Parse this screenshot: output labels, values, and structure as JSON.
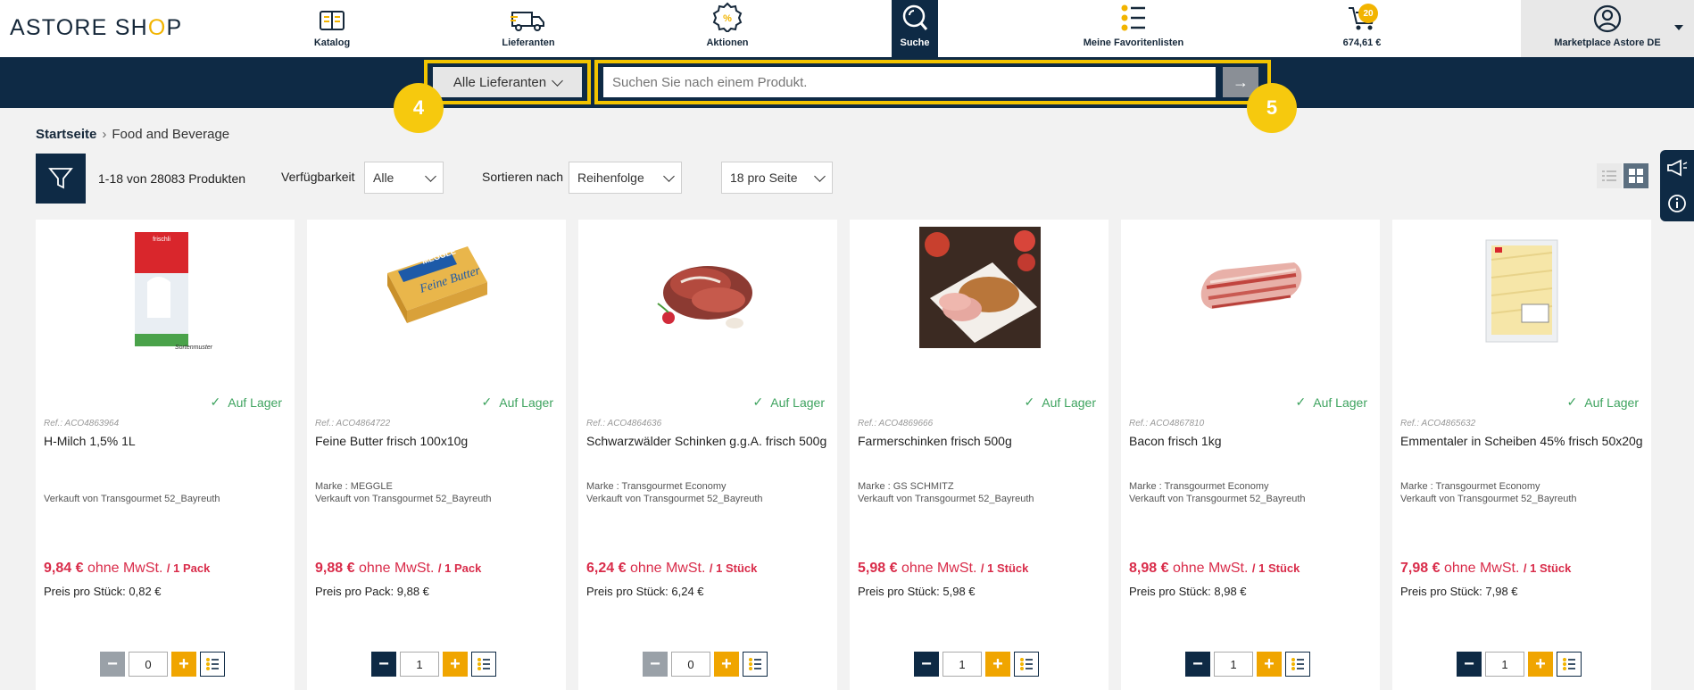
{
  "header": {
    "logo_prefix": "ASTORE SH",
    "logo_o": "O",
    "logo_suffix": "P",
    "nav": [
      {
        "label": "Katalog",
        "icon": "catalog-book-icon"
      },
      {
        "label": "Lieferanten",
        "icon": "delivery-truck-icon"
      },
      {
        "label": "Aktionen",
        "icon": "discount-badge-icon"
      },
      {
        "label": "Suche",
        "icon": "search-icon",
        "active": true
      },
      {
        "label": "Meine Favoritenlisten",
        "icon": "favorite-list-icon"
      },
      {
        "label": "674,61 €",
        "icon": "shopping-cart-icon",
        "badge": "20"
      }
    ],
    "account_label": "Marketplace Astore DE"
  },
  "search": {
    "supplier_select": "Alle Lieferanten",
    "placeholder": "Suchen Sie nach einem Produkt.",
    "submit_glyph": "→",
    "callouts": [
      "4",
      "5"
    ]
  },
  "breadcrumb": {
    "home": "Startseite",
    "current": "Food and Beverage"
  },
  "toolbar": {
    "count": "1-18 von 28083 Produkten",
    "availability_label": "Verfügbarkeit",
    "availability_value": "Alle",
    "sort_label": "Sortieren nach",
    "sort_value": "Reihenfolge",
    "per_page_value": "18 pro Seite"
  },
  "colors": {
    "navy": "#0e2a45",
    "accent": "#f0a500",
    "price": "#d92c4a",
    "stock": "#3ea35f"
  },
  "products": [
    {
      "stock": "Auf Lager",
      "ref": "Ref.: ACO4863964",
      "name": "H-Milch 1,5% 1L",
      "marke": "",
      "seller": "Verkauft von Transgourmet 52_Bayreuth",
      "price": "9,84 €",
      "vat": "ohne MwSt.",
      "unit": "/ 1 Pack",
      "ppu": "Preis pro Stück: 0,82 €",
      "qty": "0",
      "image": "milk-carton-image",
      "image_caption": "Sortenmuster"
    },
    {
      "stock": "Auf Lager",
      "ref": "Ref.: ACO4864722",
      "name": "Feine Butter frisch 100x10g",
      "marke": "Marke : MEGGLE",
      "seller": "Verkauft von Transgourmet 52_Bayreuth",
      "price": "9,88 €",
      "vat": "ohne MwSt.",
      "unit": "/ 1 Pack",
      "ppu": "Preis pro Pack: 9,88 €",
      "qty": "1",
      "image": "butter-pack-image",
      "image_brand": "MEGGLE",
      "image_text": "Feine Butter"
    },
    {
      "stock": "Auf Lager",
      "ref": "Ref.: ACO4864636",
      "name": "Schwarzwälder Schinken g.g.A. frisch 500g",
      "marke": "Marke : Transgourmet Economy",
      "seller": "Verkauft von Transgourmet 52_Bayreuth",
      "price": "6,24 €",
      "vat": "ohne MwSt.",
      "unit": "/ 1 Stück",
      "ppu": "Preis pro Stück: 6,24 €",
      "qty": "0",
      "image": "ham-slices-image"
    },
    {
      "stock": "Auf Lager",
      "ref": "Ref.: ACO4869666",
      "name": "Farmerschinken frisch 500g",
      "marke": "Marke : GS SCHMITZ",
      "seller": "Verkauft von Transgourmet 52_Bayreuth",
      "price": "5,98 €",
      "vat": "ohne MwSt.",
      "unit": "/ 1 Stück",
      "ppu": "Preis pro Stück: 5,98 €",
      "qty": "1",
      "image": "farmer-ham-plate-image"
    },
    {
      "stock": "Auf Lager",
      "ref": "Ref.: ACO4867810",
      "name": "Bacon frisch 1kg",
      "marke": "Marke : Transgourmet Economy",
      "seller": "Verkauft von Transgourmet 52_Bayreuth",
      "price": "8,98 €",
      "vat": "ohne MwSt.",
      "unit": "/ 1 Stück",
      "ppu": "Preis pro Stück: 8,98 €",
      "qty": "1",
      "image": "bacon-strips-image"
    },
    {
      "stock": "Auf Lager",
      "ref": "Ref.: ACO4865632",
      "name": "Emmentaler in Scheiben 45% frisch 50x20g",
      "marke": "Marke : Transgourmet Economy",
      "seller": "Verkauft von Transgourmet 52_Bayreuth",
      "price": "7,98 €",
      "vat": "ohne MwSt.",
      "unit": "/ 1 Stück",
      "ppu": "Preis pro Stück: 7,98 €",
      "qty": "1",
      "image": "cheese-slices-pack-image"
    }
  ]
}
